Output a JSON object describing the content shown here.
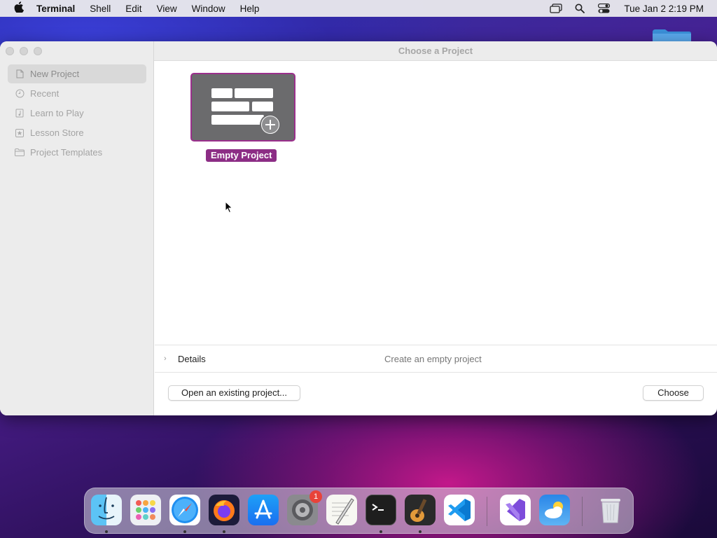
{
  "menubar": {
    "app_name": "Terminal",
    "menus": [
      "Shell",
      "Edit",
      "View",
      "Window",
      "Help"
    ],
    "clock": "Tue Jan 2  2:19 PM"
  },
  "window": {
    "title": "Choose a Project",
    "sidebar": [
      {
        "label": "New Project",
        "icon": "document-icon",
        "selected": true
      },
      {
        "label": "Recent",
        "icon": "clock-icon",
        "selected": false
      },
      {
        "label": "Learn to Play",
        "icon": "music-book-icon",
        "selected": false
      },
      {
        "label": "Lesson Store",
        "icon": "star-icon",
        "selected": false
      },
      {
        "label": "Project Templates",
        "icon": "folder-icon",
        "selected": false
      }
    ],
    "project_tile_label": "Empty Project",
    "details_label": "Details",
    "details_description": "Create an empty project",
    "open_existing_label": "Open an existing project...",
    "choose_label": "Choose"
  },
  "dock": {
    "apps": [
      "Finder",
      "Launchpad",
      "Safari",
      "Firefox",
      "App Store",
      "System Settings",
      "TextEdit",
      "Terminal",
      "GarageBand",
      "Visual Studio Code",
      "Visual Studio",
      "Weather",
      "Trash"
    ],
    "system_settings_badge": "1"
  },
  "colors": {
    "tile_accent": "#8c2d85",
    "tile_bg": "#6b6b6d",
    "badge": "#e8433a"
  }
}
